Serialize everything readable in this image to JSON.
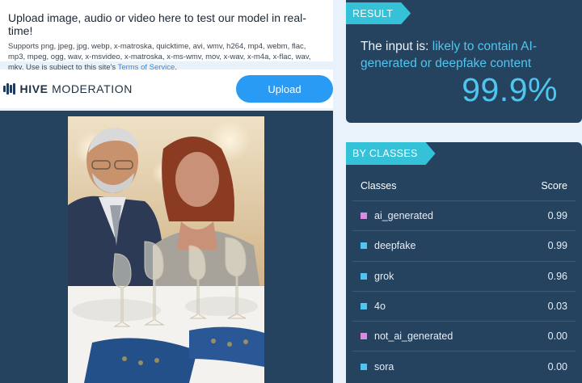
{
  "upload": {
    "title": "Upload image, audio or video here to test our model in real-time!",
    "description": "Supports png, jpeg, jpg, webp, x-matroska, quicktime, avi, wmv, h264, mp4, webm, flac, mp3, mpeg, ogg, wav, x-msvideo, x-matroska, x-ms-wmv, mov, x-wav, x-m4a, x-flac, wav, mkv. Use is subject to this site's ",
    "terms_link": "Terms of Service",
    "terms_suffix": ".",
    "button_label": "Upload"
  },
  "brand": {
    "name_bold": "HIVE",
    "name_rest": " MODERATION",
    "logo_icon": "hive-bars-icon"
  },
  "result": {
    "tab_label": "RESULT",
    "prefix": "The input is: ",
    "verdict": "likely to contain AI-generated or deepfake content",
    "score": "99.9%",
    "accent_color": "#4fc6ef"
  },
  "classes": {
    "tab_label": "BY CLASSES",
    "col_class": "Classes",
    "col_score": "Score",
    "rows": [
      {
        "name": "ai_generated",
        "score": "0.99",
        "color": "#d98be0"
      },
      {
        "name": "deepfake",
        "score": "0.99",
        "color": "#4fc6ef"
      },
      {
        "name": "grok",
        "score": "0.96",
        "color": "#4fc6ef"
      },
      {
        "name": "4o",
        "score": "0.03",
        "color": "#4fc6ef"
      },
      {
        "name": "not_ai_generated",
        "score": "0.00",
        "color": "#d98be0"
      },
      {
        "name": "sora",
        "score": "0.00",
        "color": "#4fc6ef"
      }
    ]
  },
  "colors": {
    "page_bg": "#e9f1fa",
    "panel_bg": "#25425e",
    "tab_bg": "#35c2d8",
    "button_bg": "#2a9bf4"
  }
}
